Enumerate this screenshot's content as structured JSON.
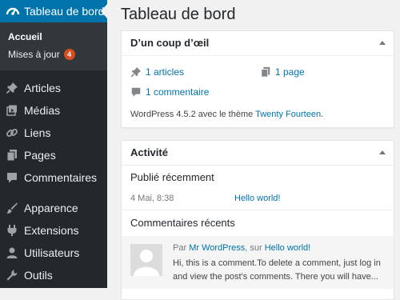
{
  "sidebar": {
    "dashboard_label": "Tableau de bord",
    "submenu": {
      "home": "Accueil",
      "updates": "Mises à jour",
      "updates_count": "4"
    },
    "items": [
      {
        "label": "Articles",
        "icon": "pin-icon"
      },
      {
        "label": "Médias",
        "icon": "media-icon"
      },
      {
        "label": "Liens",
        "icon": "links-icon"
      },
      {
        "label": "Pages",
        "icon": "pages-icon"
      },
      {
        "label": "Commentaires",
        "icon": "comments-icon"
      },
      {
        "label": "Apparence",
        "icon": "appearance-icon"
      },
      {
        "label": "Extensions",
        "icon": "plugins-icon"
      },
      {
        "label": "Utilisateurs",
        "icon": "users-icon"
      },
      {
        "label": "Outils",
        "icon": "tools-icon"
      }
    ]
  },
  "main": {
    "title": "Tableau de bord",
    "glance": {
      "title": "D’un coup d’œil",
      "articles": "1 articles",
      "page": "1 page",
      "comment": "1 commentaire",
      "version_prefix": "WordPress 4.5.2 avec le thème ",
      "theme": "Twenty Fourteen",
      "version_suffix": "."
    },
    "activity": {
      "title": "Activité",
      "recent_heading": "Publié récemment",
      "post_date": "4 Mai, 8:38",
      "post_link": "Hello world!",
      "comments_heading": "Commentaires récents",
      "comment_by": "Par ",
      "comment_author": "Mr WordPress",
      "comment_on": ", sur ",
      "comment_post": "Hello world!",
      "comment_line1": "Hi, this is a comment.To delete a comment, just log in",
      "comment_line2": "and view the post's comments. There you will have..."
    }
  },
  "colors": {
    "sidebar_bg": "#23282d",
    "submenu_bg": "#32373c",
    "accent": "#0073aa",
    "badge": "#d54e21",
    "page_bg": "#f1f1f1"
  }
}
